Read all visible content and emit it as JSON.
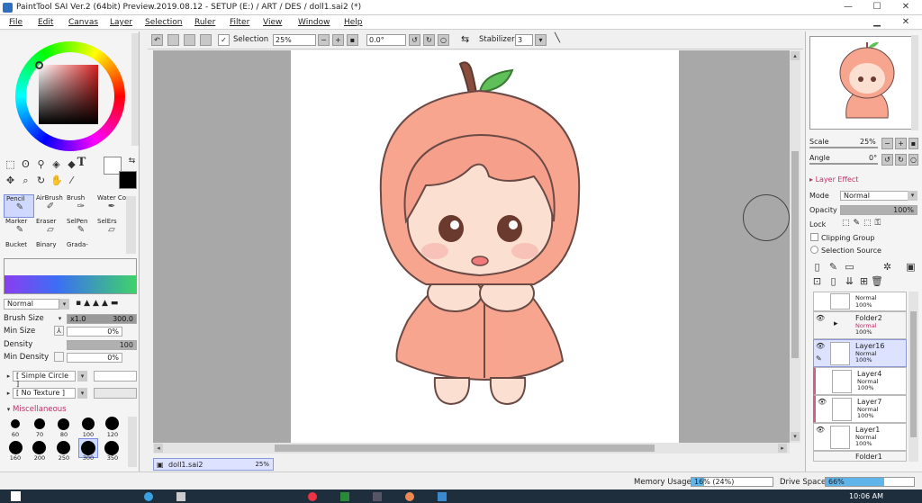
{
  "window": {
    "title": "PaintTool SAI Ver.2 (64bit) Preview.2019.08.12 - SETUP (E:) / ART / DES / doll1.sai2 (*)"
  },
  "menu": [
    "File",
    "Edit",
    "Canvas",
    "Layer",
    "Selection",
    "Ruler",
    "Filter",
    "View",
    "Window",
    "Help"
  ],
  "toolbar": {
    "selection_label": "Selection",
    "zoom": "25%",
    "angle": "0.0°",
    "stabilizer_label": "Stabilizer",
    "stabilizer_value": "3"
  },
  "tools": {
    "row1": [
      "Pencil",
      "AirBrush",
      "Brush",
      "Water Color"
    ],
    "row2": [
      "Marker",
      "Eraser",
      "SelPen",
      "SelErs"
    ],
    "row3": [
      "Bucket",
      "Binary",
      "Grada-"
    ]
  },
  "brush": {
    "mode": "Normal",
    "size_label": "Brush Size",
    "size_mult": "x1.0",
    "size_value": "300.0",
    "min_size_label": "Min Size",
    "min_size_value": "0%",
    "density_label": "Density",
    "density_value": "100",
    "min_density_label": "Min Density",
    "min_density_value": "0%",
    "shape": "[ Simple Circle ]",
    "texture": "[ No Texture ]",
    "misc_label": "Miscellaneous",
    "presets_row1": [
      "60",
      "70",
      "80",
      "100",
      "120"
    ],
    "presets_row2": [
      "160",
      "200",
      "250",
      "300",
      "350"
    ]
  },
  "navigator": {
    "scale_label": "Scale",
    "scale_value": "25%",
    "angle_label": "Angle",
    "angle_value": "0°"
  },
  "layer_panel": {
    "effect_label": "Layer Effect",
    "mode_label": "Mode",
    "mode_value": "Normal",
    "opacity_label": "Opacity",
    "opacity_value": "100%",
    "lock_label": "Lock",
    "clipping_label": "Clipping Group",
    "selection_source_label": "Selection Source",
    "layers": [
      {
        "name": "",
        "mode": "Normal",
        "opacity": "100%"
      },
      {
        "name": "Folder2",
        "mode": "Normal",
        "opacity": "100%"
      },
      {
        "name": "Layer16",
        "mode": "Normal",
        "opacity": "100%"
      },
      {
        "name": "Layer4",
        "mode": "Normal",
        "opacity": "100%"
      },
      {
        "name": "Layer7",
        "mode": "Normal",
        "opacity": "100%"
      },
      {
        "name": "Layer1",
        "mode": "Normal",
        "opacity": "100%"
      },
      {
        "name": "Folder1",
        "mode": "",
        "opacity": ""
      }
    ]
  },
  "doc_tab": {
    "name": "doll1.sai2",
    "zoom": "25%"
  },
  "status": {
    "memory_label": "Memory Usage",
    "memory_value": "16% (24%)",
    "memory_pct": 16,
    "drive_label": "Drive Space",
    "drive_value": "66%",
    "drive_pct": 66
  },
  "taskbar": {
    "time": "10:06 AM"
  },
  "colors": {
    "accent": "#5fb4ea",
    "selected_tool": "#cfd8ff",
    "peach": "#f7a58f",
    "outline": "#6b4a45"
  }
}
